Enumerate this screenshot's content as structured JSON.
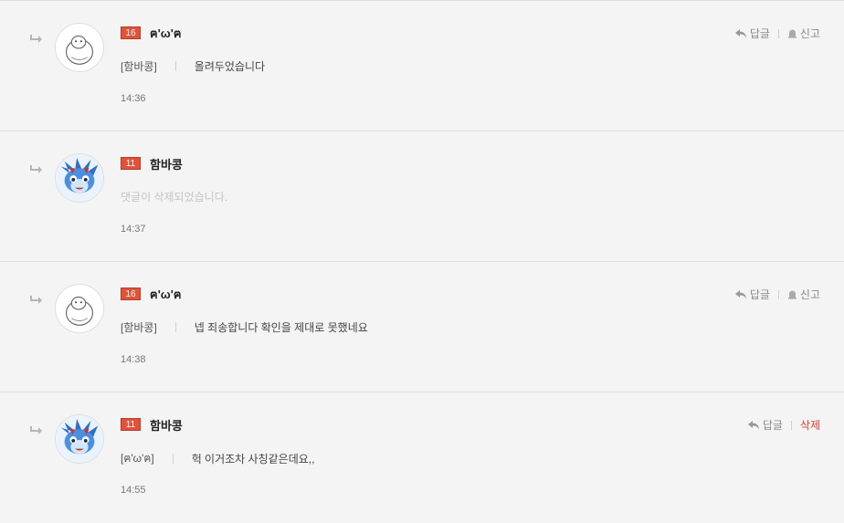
{
  "comments": [
    {
      "level": "16",
      "nickname": "ฅ'ω'ฅ",
      "mention": "[함바콩]",
      "text": "올려두었습니다",
      "time": "14:36",
      "reply_label": "답글",
      "report_label": "신고"
    },
    {
      "level": "11",
      "nickname": "함바콩",
      "deleted_text": "댓글이 삭제되었습니다.",
      "time": "14:37"
    },
    {
      "level": "16",
      "nickname": "ฅ'ω'ฅ",
      "mention": "[함바콩]",
      "text": "넵 죄송합니다 확인을 제대로 못했네요",
      "time": "14:38",
      "reply_label": "답글",
      "report_label": "신고"
    },
    {
      "level": "11",
      "nickname": "함바콩",
      "mention": "[ฅ'ω'ฅ]",
      "text": "헉 이거조차 사칭같은데요,,",
      "time": "14:55",
      "reply_label": "답글",
      "delete_label": "삭제"
    }
  ],
  "colors": {
    "level_badge": "#e0533a",
    "delete_action": "#e53935",
    "deleted_text": "#c4c4c4"
  }
}
